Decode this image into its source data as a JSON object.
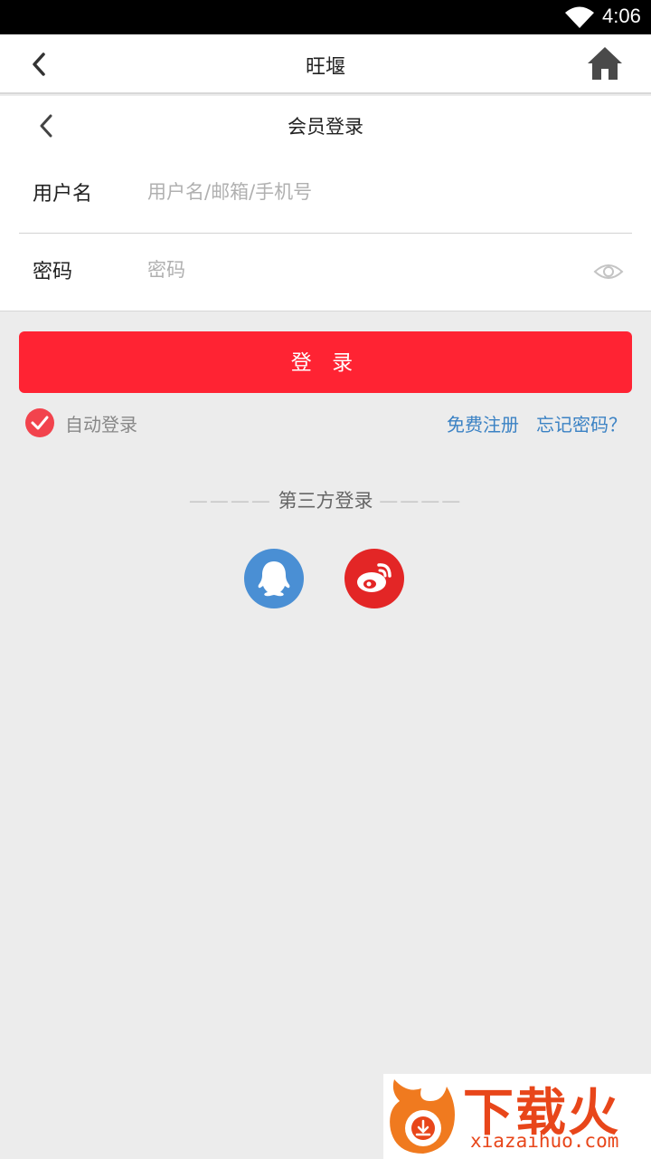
{
  "status_bar": {
    "time": "4:06"
  },
  "header": {
    "title": "旺堰"
  },
  "login": {
    "subtitle": "会员登录",
    "username_label": "用户名",
    "username_placeholder": "用户名/邮箱/手机号",
    "password_label": "密码",
    "password_placeholder": "密码",
    "login_button": "登 录",
    "auto_login": "自动登录",
    "register_link": "免费注册",
    "forgot_link": "忘记密码？"
  },
  "third_party": {
    "title": "第三方登录",
    "dash": "————",
    "providers": [
      {
        "icon": "qq-icon",
        "color": "#4a8fd4"
      },
      {
        "icon": "weibo-icon",
        "color": "#e32626"
      }
    ]
  },
  "watermark": {
    "brand": "下载火",
    "domain": "xiazaihuo.com"
  },
  "colors": {
    "accent": "#ff2333",
    "link": "#3b82c4",
    "check": "#f2434d",
    "background": "#ececec"
  }
}
